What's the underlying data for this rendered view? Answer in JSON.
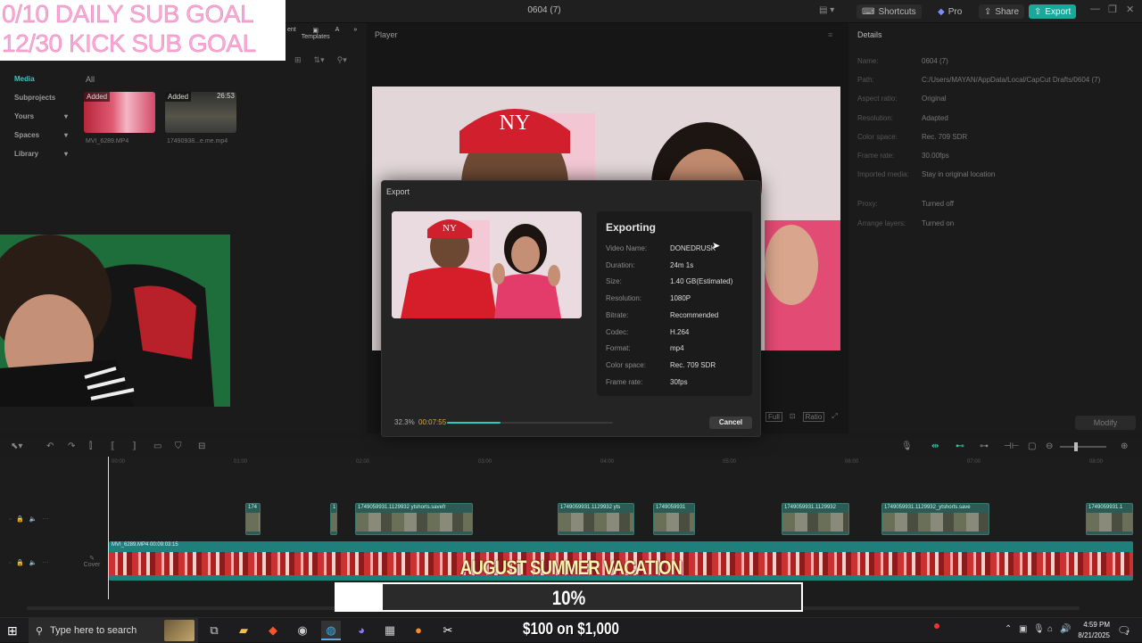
{
  "app": {
    "title": "0604 (7)",
    "shortcuts": "Shortcuts",
    "pro": "Pro",
    "share": "Share",
    "export": "Export"
  },
  "overlay": {
    "daily_goal": "0/10 DAILY SUB GOAL",
    "kick_goal": "12/30 KICK SUB GOAL",
    "banner": "AUGUST SUMMER VACATION",
    "goal_percent": "10%",
    "goal_fraction": 0.1,
    "money": "$100 on $1,000"
  },
  "media": {
    "tab_templates": "Templates",
    "nav": [
      {
        "label": "Media",
        "active": true
      },
      {
        "label": "Subprojects"
      },
      {
        "label": "Yours"
      },
      {
        "label": "Spaces"
      },
      {
        "label": "Library"
      }
    ],
    "all": "All",
    "items": [
      {
        "tag": "Added",
        "name": "MVI_6289.MP4"
      },
      {
        "tag": "Added",
        "duration": "26:53",
        "name": "17490938...e.me.mp4"
      }
    ]
  },
  "player": {
    "label": "Player"
  },
  "details": {
    "title": "Details",
    "rows": [
      {
        "k": "Name:",
        "v": "0604 (7)"
      },
      {
        "k": "Path:",
        "v": "C:/Users/MAYAN/AppData/Local/CapCut Drafts/0604 (7)"
      },
      {
        "k": "Aspect ratio:",
        "v": "Original"
      },
      {
        "k": "Resolution:",
        "v": "Adapted"
      },
      {
        "k": "Color space:",
        "v": "Rec. 709 SDR"
      },
      {
        "k": "Frame rate:",
        "v": "30.00fps"
      },
      {
        "k": "Imported media:",
        "v": "Stay in original location"
      },
      {
        "k": "Proxy:",
        "v": "Turned off"
      },
      {
        "k": "Arrange layers:",
        "v": "Turned on"
      }
    ],
    "modify": "Modify"
  },
  "export_dialog": {
    "title": "Export",
    "heading": "Exporting",
    "rows": [
      {
        "k": "Video Name:",
        "v": "DONEDRUSK"
      },
      {
        "k": "Duration:",
        "v": "24m 1s"
      },
      {
        "k": "Size:",
        "v": "1.40 GB(Estimated)"
      },
      {
        "k": "Resolution:",
        "v": "1080P"
      },
      {
        "k": "Bitrate:",
        "v": "Recommended"
      },
      {
        "k": "Codec:",
        "v": "H.264"
      },
      {
        "k": "Format:",
        "v": "mp4"
      },
      {
        "k": "Color space:",
        "v": "Rec. 709 SDR"
      },
      {
        "k": "Frame rate:",
        "v": "30fps"
      }
    ],
    "progress_label": "32.3%",
    "progress": 0.323,
    "elapsed": "00:07:55",
    "cancel": "Cancel"
  },
  "player_controls": {
    "full": "Full",
    "ratio": "Ratio"
  },
  "timeline": {
    "ticks": [
      "00:00",
      "01:00",
      "02:00",
      "03:00",
      "04:00",
      "05:00",
      "06:00",
      "07:00",
      "08:00"
    ],
    "main_clip": "MVI_6289.MP4  00:09:03:15",
    "cover": "Cover",
    "clips": [
      {
        "label": "174"
      },
      {
        "label": "1"
      },
      {
        "label": "1749059931.1129932 ytshorts.savefr"
      },
      {
        "label": "1749059931.1129932 yts"
      },
      {
        "label": "1749059931"
      },
      {
        "label": "1749059931.1129932"
      },
      {
        "label": "1749059931.1129932_ytshorts.save"
      },
      {
        "label": "1749059931.1"
      }
    ]
  },
  "taskbar": {
    "search_placeholder": "Type here to search",
    "time": "4:59 PM",
    "date": "8/21/2025",
    "notification_count": "7"
  },
  "colors": {
    "accent": "#19a89a",
    "progress": "#2ec9c0",
    "goal_pink": "#ffa8d8"
  }
}
